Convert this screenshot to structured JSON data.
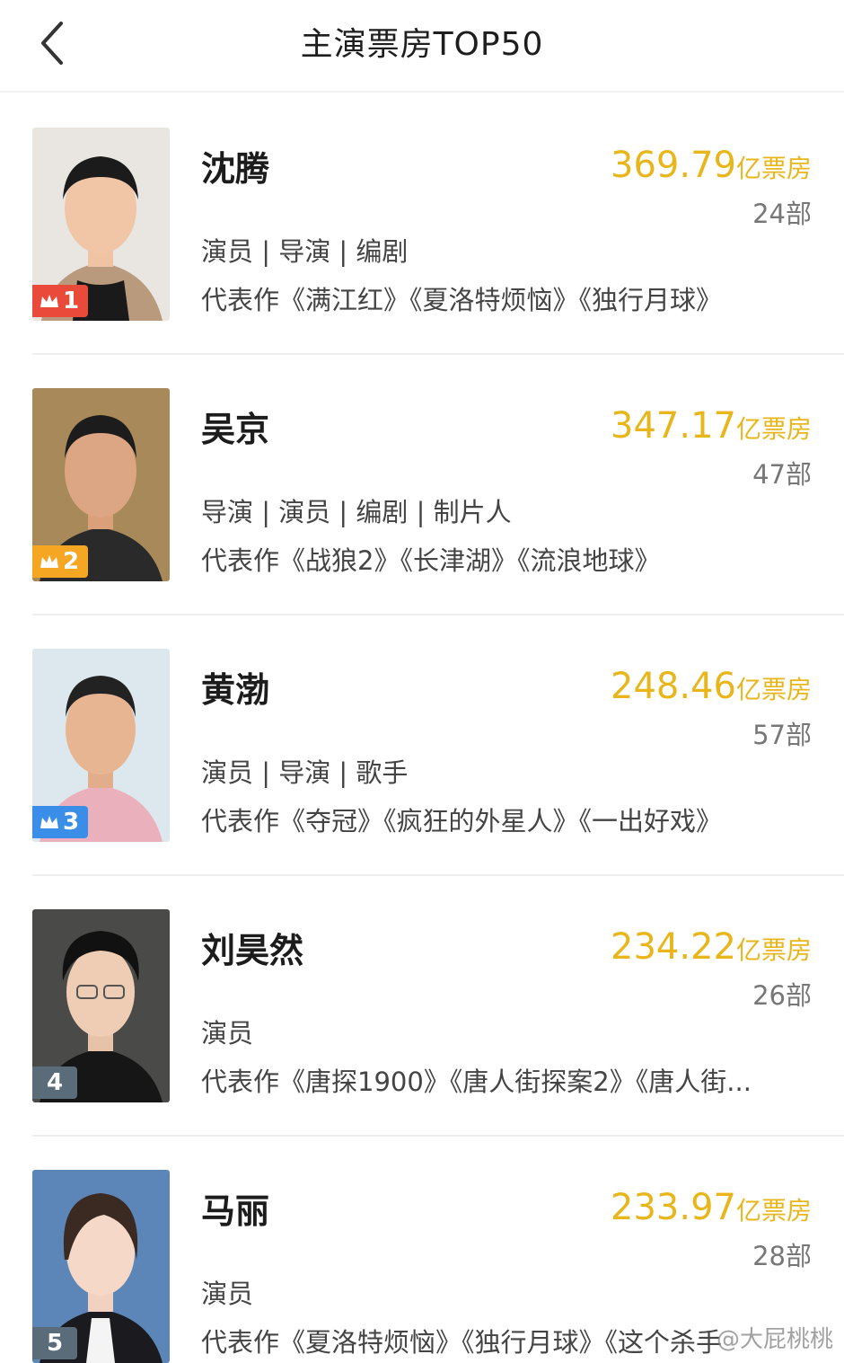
{
  "header": {
    "title": "主演票房TOP50",
    "back_icon": "chevron-left-icon"
  },
  "colors": {
    "accent_gold": "#e8b51b",
    "rank1": "#e94a3a",
    "rank2": "#f5a623",
    "rank3": "#3b8ee8",
    "rank_other": "#5a6b7a"
  },
  "actors": [
    {
      "rank": "1",
      "name": "沈腾",
      "amount": "369.79",
      "unit": "亿票房",
      "count": "24部",
      "roles": "演员 | 导演 | 编剧",
      "works": "代表作《满江红》《夏洛特烦恼》《独行月球》"
    },
    {
      "rank": "2",
      "name": "吴京",
      "amount": "347.17",
      "unit": "亿票房",
      "count": "47部",
      "roles": "导演 | 演员 | 编剧 | 制片人",
      "works": "代表作《战狼2》《长津湖》《流浪地球》"
    },
    {
      "rank": "3",
      "name": "黄渤",
      "amount": "248.46",
      "unit": "亿票房",
      "count": "57部",
      "roles": "演员 | 导演 | 歌手",
      "works": "代表作《夺冠》《疯狂的外星人》《一出好戏》"
    },
    {
      "rank": "4",
      "name": "刘昊然",
      "amount": "234.22",
      "unit": "亿票房",
      "count": "26部",
      "roles": "演员",
      "works": "代表作《唐探1900》《唐人街探案2》《唐人街..."
    },
    {
      "rank": "5",
      "name": "马丽",
      "amount": "233.97",
      "unit": "亿票房",
      "count": "28部",
      "roles": "演员",
      "works": "代表作《夏洛特烦恼》《独行月球》《这个杀手"
    }
  ],
  "watermark": "@大屁桃桃"
}
